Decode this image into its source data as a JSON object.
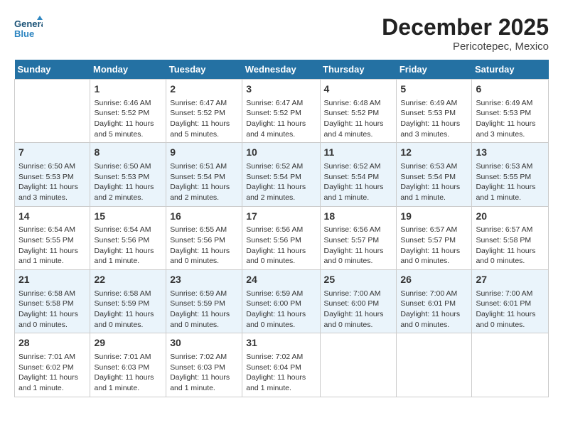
{
  "header": {
    "logo_text_general": "General",
    "logo_text_blue": "Blue",
    "month_title": "December 2025",
    "location": "Pericotepec, Mexico"
  },
  "days_of_week": [
    "Sunday",
    "Monday",
    "Tuesday",
    "Wednesday",
    "Thursday",
    "Friday",
    "Saturday"
  ],
  "weeks": [
    [
      {
        "day": "",
        "sunrise": "",
        "sunset": "",
        "daylight": ""
      },
      {
        "day": "1",
        "sunrise": "Sunrise: 6:46 AM",
        "sunset": "Sunset: 5:52 PM",
        "daylight": "Daylight: 11 hours and 5 minutes."
      },
      {
        "day": "2",
        "sunrise": "Sunrise: 6:47 AM",
        "sunset": "Sunset: 5:52 PM",
        "daylight": "Daylight: 11 hours and 5 minutes."
      },
      {
        "day": "3",
        "sunrise": "Sunrise: 6:47 AM",
        "sunset": "Sunset: 5:52 PM",
        "daylight": "Daylight: 11 hours and 4 minutes."
      },
      {
        "day": "4",
        "sunrise": "Sunrise: 6:48 AM",
        "sunset": "Sunset: 5:52 PM",
        "daylight": "Daylight: 11 hours and 4 minutes."
      },
      {
        "day": "5",
        "sunrise": "Sunrise: 6:49 AM",
        "sunset": "Sunset: 5:53 PM",
        "daylight": "Daylight: 11 hours and 3 minutes."
      },
      {
        "day": "6",
        "sunrise": "Sunrise: 6:49 AM",
        "sunset": "Sunset: 5:53 PM",
        "daylight": "Daylight: 11 hours and 3 minutes."
      }
    ],
    [
      {
        "day": "7",
        "sunrise": "Sunrise: 6:50 AM",
        "sunset": "Sunset: 5:53 PM",
        "daylight": "Daylight: 11 hours and 3 minutes."
      },
      {
        "day": "8",
        "sunrise": "Sunrise: 6:50 AM",
        "sunset": "Sunset: 5:53 PM",
        "daylight": "Daylight: 11 hours and 2 minutes."
      },
      {
        "day": "9",
        "sunrise": "Sunrise: 6:51 AM",
        "sunset": "Sunset: 5:54 PM",
        "daylight": "Daylight: 11 hours and 2 minutes."
      },
      {
        "day": "10",
        "sunrise": "Sunrise: 6:52 AM",
        "sunset": "Sunset: 5:54 PM",
        "daylight": "Daylight: 11 hours and 2 minutes."
      },
      {
        "day": "11",
        "sunrise": "Sunrise: 6:52 AM",
        "sunset": "Sunset: 5:54 PM",
        "daylight": "Daylight: 11 hours and 1 minute."
      },
      {
        "day": "12",
        "sunrise": "Sunrise: 6:53 AM",
        "sunset": "Sunset: 5:54 PM",
        "daylight": "Daylight: 11 hours and 1 minute."
      },
      {
        "day": "13",
        "sunrise": "Sunrise: 6:53 AM",
        "sunset": "Sunset: 5:55 PM",
        "daylight": "Daylight: 11 hours and 1 minute."
      }
    ],
    [
      {
        "day": "14",
        "sunrise": "Sunrise: 6:54 AM",
        "sunset": "Sunset: 5:55 PM",
        "daylight": "Daylight: 11 hours and 1 minute."
      },
      {
        "day": "15",
        "sunrise": "Sunrise: 6:54 AM",
        "sunset": "Sunset: 5:56 PM",
        "daylight": "Daylight: 11 hours and 1 minute."
      },
      {
        "day": "16",
        "sunrise": "Sunrise: 6:55 AM",
        "sunset": "Sunset: 5:56 PM",
        "daylight": "Daylight: 11 hours and 0 minutes."
      },
      {
        "day": "17",
        "sunrise": "Sunrise: 6:56 AM",
        "sunset": "Sunset: 5:56 PM",
        "daylight": "Daylight: 11 hours and 0 minutes."
      },
      {
        "day": "18",
        "sunrise": "Sunrise: 6:56 AM",
        "sunset": "Sunset: 5:57 PM",
        "daylight": "Daylight: 11 hours and 0 minutes."
      },
      {
        "day": "19",
        "sunrise": "Sunrise: 6:57 AM",
        "sunset": "Sunset: 5:57 PM",
        "daylight": "Daylight: 11 hours and 0 minutes."
      },
      {
        "day": "20",
        "sunrise": "Sunrise: 6:57 AM",
        "sunset": "Sunset: 5:58 PM",
        "daylight": "Daylight: 11 hours and 0 minutes."
      }
    ],
    [
      {
        "day": "21",
        "sunrise": "Sunrise: 6:58 AM",
        "sunset": "Sunset: 5:58 PM",
        "daylight": "Daylight: 11 hours and 0 minutes."
      },
      {
        "day": "22",
        "sunrise": "Sunrise: 6:58 AM",
        "sunset": "Sunset: 5:59 PM",
        "daylight": "Daylight: 11 hours and 0 minutes."
      },
      {
        "day": "23",
        "sunrise": "Sunrise: 6:59 AM",
        "sunset": "Sunset: 5:59 PM",
        "daylight": "Daylight: 11 hours and 0 minutes."
      },
      {
        "day": "24",
        "sunrise": "Sunrise: 6:59 AM",
        "sunset": "Sunset: 6:00 PM",
        "daylight": "Daylight: 11 hours and 0 minutes."
      },
      {
        "day": "25",
        "sunrise": "Sunrise: 7:00 AM",
        "sunset": "Sunset: 6:00 PM",
        "daylight": "Daylight: 11 hours and 0 minutes."
      },
      {
        "day": "26",
        "sunrise": "Sunrise: 7:00 AM",
        "sunset": "Sunset: 6:01 PM",
        "daylight": "Daylight: 11 hours and 0 minutes."
      },
      {
        "day": "27",
        "sunrise": "Sunrise: 7:00 AM",
        "sunset": "Sunset: 6:01 PM",
        "daylight": "Daylight: 11 hours and 0 minutes."
      }
    ],
    [
      {
        "day": "28",
        "sunrise": "Sunrise: 7:01 AM",
        "sunset": "Sunset: 6:02 PM",
        "daylight": "Daylight: 11 hours and 1 minute."
      },
      {
        "day": "29",
        "sunrise": "Sunrise: 7:01 AM",
        "sunset": "Sunset: 6:03 PM",
        "daylight": "Daylight: 11 hours and 1 minute."
      },
      {
        "day": "30",
        "sunrise": "Sunrise: 7:02 AM",
        "sunset": "Sunset: 6:03 PM",
        "daylight": "Daylight: 11 hours and 1 minute."
      },
      {
        "day": "31",
        "sunrise": "Sunrise: 7:02 AM",
        "sunset": "Sunset: 6:04 PM",
        "daylight": "Daylight: 11 hours and 1 minute."
      },
      {
        "day": "",
        "sunrise": "",
        "sunset": "",
        "daylight": ""
      },
      {
        "day": "",
        "sunrise": "",
        "sunset": "",
        "daylight": ""
      },
      {
        "day": "",
        "sunrise": "",
        "sunset": "",
        "daylight": ""
      }
    ]
  ]
}
